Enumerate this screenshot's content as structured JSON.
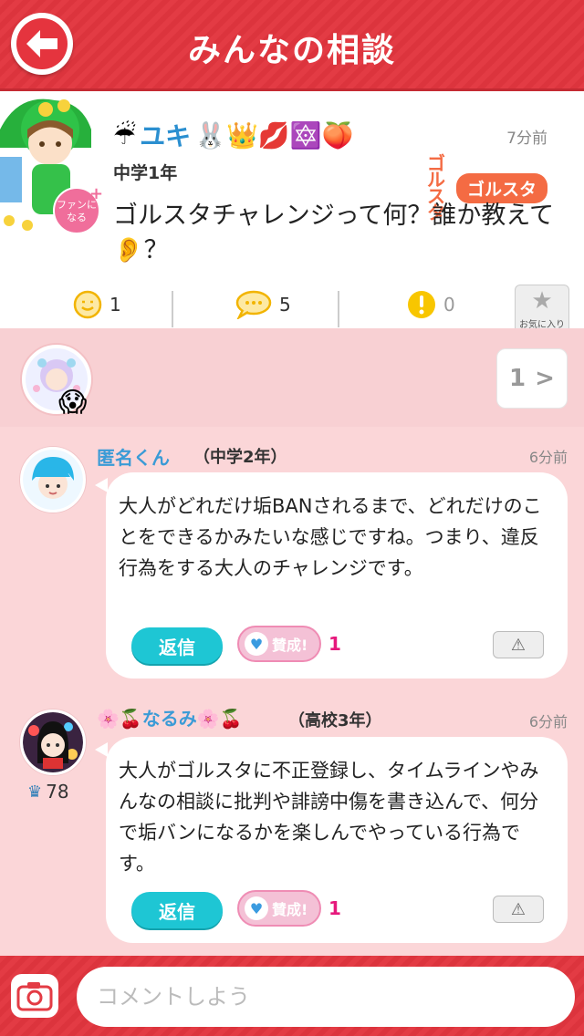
{
  "header": {
    "title": "みんなの相談"
  },
  "post": {
    "name_prefix": "☔",
    "name": "ユキ",
    "name_suffix": "🐰👑💋🔯🍑",
    "grade": "中学1年",
    "time": "7分前",
    "brand_logo": "ゴル\nスタ",
    "brand_tag": "ゴルスタ",
    "fan_badge": "ファンに\nなる",
    "text": "ゴルスタチャレンジって何？誰か教えて👂？",
    "stats": {
      "smile": "1",
      "comment": "5",
      "alert": "0"
    },
    "favorite_label": "お気に入り"
  },
  "reactions": {
    "emoji": "😱",
    "page": "1"
  },
  "comments": [
    {
      "name": "匿名くん",
      "grade": "（中学2年）",
      "time": "6分前",
      "text": "大人がどれだけ垢BANされるまで、どれだけのことをできるかみたいな感じですね。つまり、違反行為をする大人のチャレンジです。",
      "reply_label": "返信",
      "agree_label": "賛成!",
      "agree_count": "1"
    },
    {
      "name": "🌸🍒なるみ🌸🍒",
      "grade": "（高校3年）",
      "time": "6分前",
      "crown_count": "78",
      "text": "大人がゴルスタに不正登録し、タイムラインやみんなの相談に批判や誹謗中傷を書き込んで、何分で垢バンになるかを楽しんでやっている行為です。",
      "reply_label": "返信",
      "agree_label": "賛成!",
      "agree_count": "1"
    }
  ],
  "composer": {
    "placeholder": "コメントしよう"
  },
  "colors": {
    "header": "#e33b44",
    "accent_blue": "#3b9bd6",
    "reply": "#1ec6d4",
    "agree_count": "#e6187c",
    "brand": "#f46b43"
  }
}
